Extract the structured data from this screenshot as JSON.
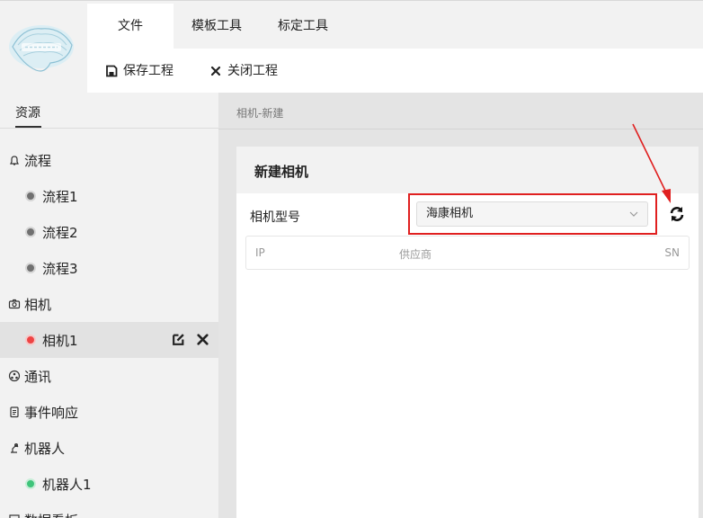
{
  "menu": {
    "tabs": [
      {
        "label": "文件",
        "active": true
      },
      {
        "label": "模板工具",
        "active": false
      },
      {
        "label": "标定工具",
        "active": false
      }
    ],
    "toolbar": {
      "save_label": "保存工程",
      "close_label": "关闭工程"
    }
  },
  "sidebar": {
    "tab_label": "资源",
    "groups": [
      {
        "label": "流程",
        "icon": "bell-icon",
        "children": [
          "流程1",
          "流程2",
          "流程3"
        ]
      },
      {
        "label": "相机",
        "icon": "camera-icon",
        "children": [
          "相机1"
        ]
      },
      {
        "label": "通讯",
        "icon": "network-icon",
        "children": []
      },
      {
        "label": "事件响应",
        "icon": "clipboard-icon",
        "children": []
      },
      {
        "label": "机器人",
        "icon": "robot-arm-icon",
        "children": [
          "机器人1"
        ]
      },
      {
        "label": "数据看板",
        "icon": "dashboard-icon",
        "children": []
      }
    ],
    "selected_item": "相机1"
  },
  "main": {
    "breadcrumb": "相机-新建",
    "panel": {
      "title": "新建相机",
      "camera_model_label": "相机型号",
      "camera_model_value": "海康相机",
      "table_headers": [
        "IP",
        "供应商",
        "SN"
      ]
    }
  },
  "colors": {
    "accent_red": "#e02020",
    "status_grey": "#707070",
    "status_red": "#ee4444",
    "status_green": "#3ec47a"
  }
}
